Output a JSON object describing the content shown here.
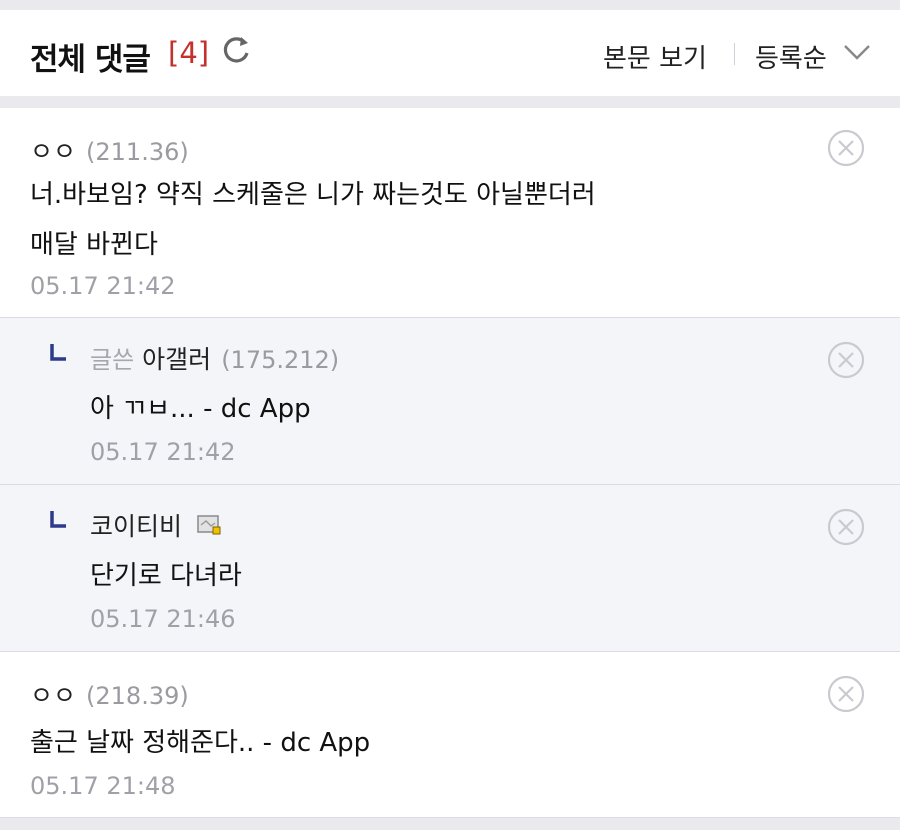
{
  "header": {
    "title": "전체 댓글",
    "count": "[4]",
    "view_body": "본문 보기",
    "sort": "등록순"
  },
  "comments": [
    {
      "author": "ㅇㅇ",
      "ip": "(211.36)",
      "lines": [
        "너.바보임? 약직 스케줄은 니가 짜는것도 아닐뿐더러",
        "매달 바뀐다"
      ],
      "date": "05.17 21:42"
    },
    {
      "writer_tag": "글쓴",
      "author": "아갤러",
      "ip": "(175.212)",
      "lines": [
        "아 ㄲㅂ... - dc App"
      ],
      "date": "05.17 21:42"
    },
    {
      "author": "코이티비",
      "lines": [
        "단기로 다녀라"
      ],
      "date": "05.17 21:46"
    },
    {
      "author": "ㅇㅇ",
      "ip": "(218.39)",
      "lines": [
        "출근 날짜 정해준다.. - dc App"
      ],
      "date": "05.17 21:48"
    }
  ],
  "colors": {
    "count": "#c4302b",
    "reply_bg": "#f4f5f9",
    "reply_arrow": "#2d3a8c"
  },
  "icons": [
    "refresh-icon",
    "chevron-down-icon",
    "delete-icon",
    "reply-arrow-icon",
    "fixed-nick-icon"
  ]
}
